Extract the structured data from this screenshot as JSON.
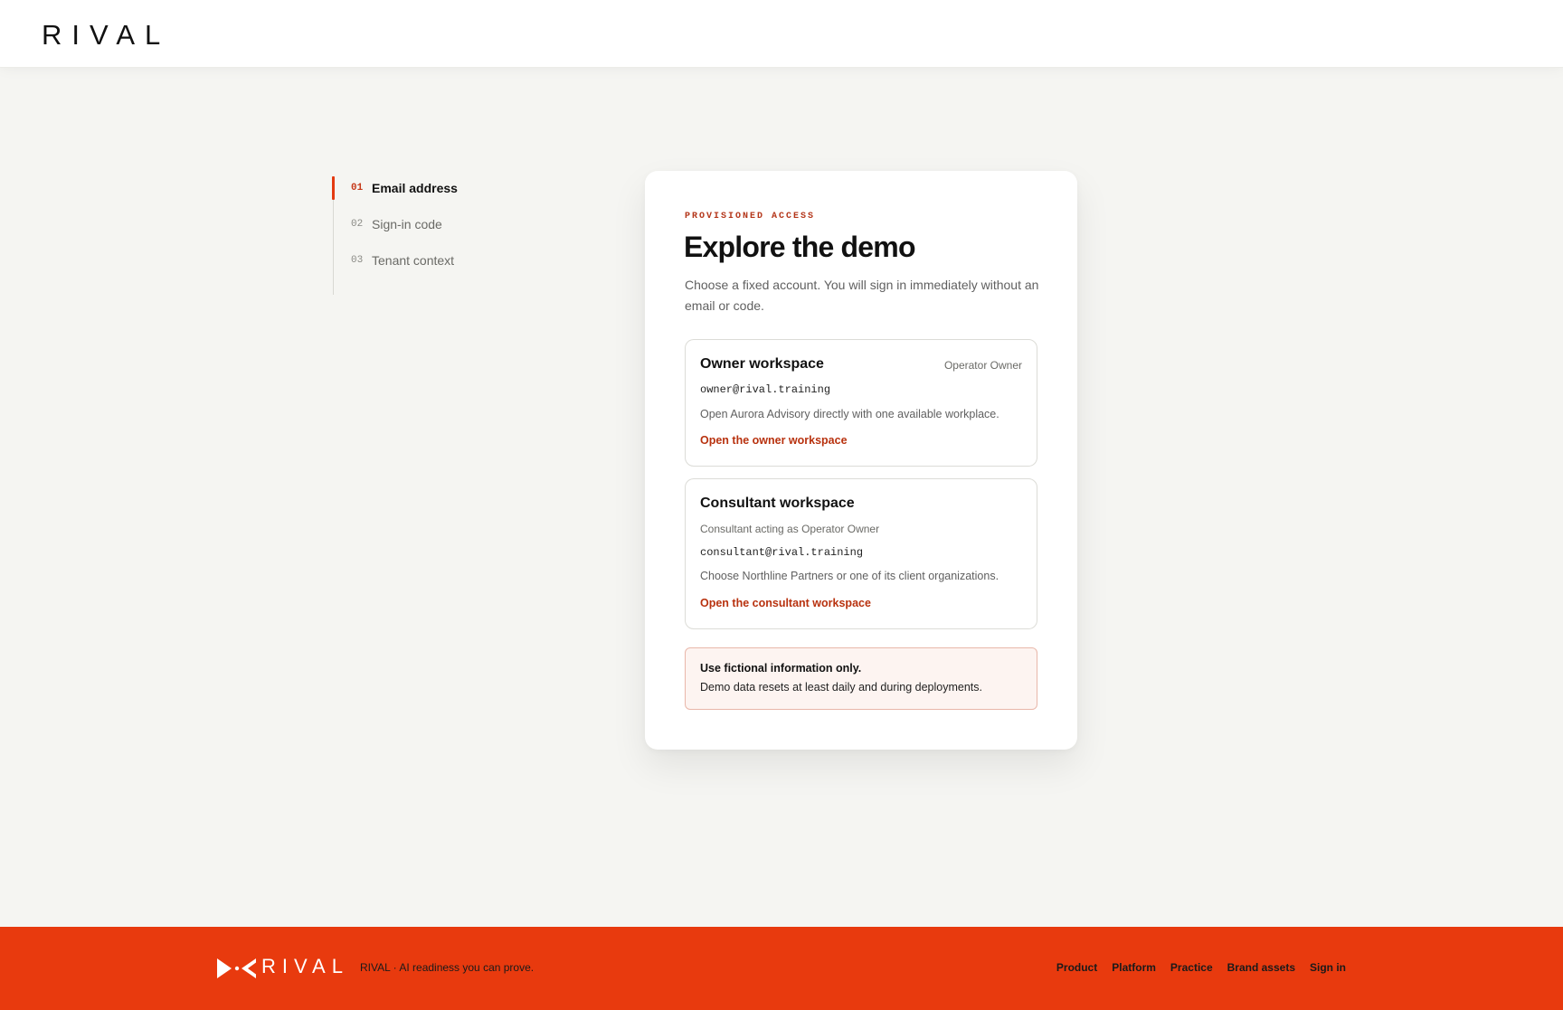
{
  "header": {
    "logo_text": "RIVAL"
  },
  "stepper": {
    "steps": [
      {
        "num": "01",
        "label": "Email address",
        "active": true
      },
      {
        "num": "02",
        "label": "Sign-in code",
        "active": false
      },
      {
        "num": "03",
        "label": "Tenant context",
        "active": false
      }
    ]
  },
  "card": {
    "eyebrow": "PROVISIONED ACCESS",
    "title": "Explore the demo",
    "lede": "Choose a fixed account. You will sign in immediately without an email or code.",
    "owner": {
      "name": "Owner workspace",
      "role": "Operator Owner",
      "email": "owner@rival.training",
      "description": "Open Aurora Advisory directly with one available workplace.",
      "link": "Open the owner workspace"
    },
    "consultant": {
      "name": "Consultant workspace",
      "subtitle": "Consultant acting as Operator Owner",
      "email": "consultant@rival.training",
      "description": "Choose Northline Partners or one of its client organizations.",
      "link": "Open the consultant workspace"
    },
    "notice": {
      "title": "Use fictional information only.",
      "body": "Demo data resets at least daily and during deployments."
    }
  },
  "footer": {
    "logo_text": "RIVAL",
    "tagline": "RIVAL · AI readiness you can prove.",
    "nav": {
      "product": "Product",
      "platform": "Platform",
      "practice": "Practice",
      "brand_assets": "Brand assets",
      "sign_in": "Sign in"
    },
    "background_color": "#e83a0e"
  },
  "colors": {
    "accent": "#e43a11",
    "link": "#b8320f",
    "page_background": "#f5f5f2"
  }
}
